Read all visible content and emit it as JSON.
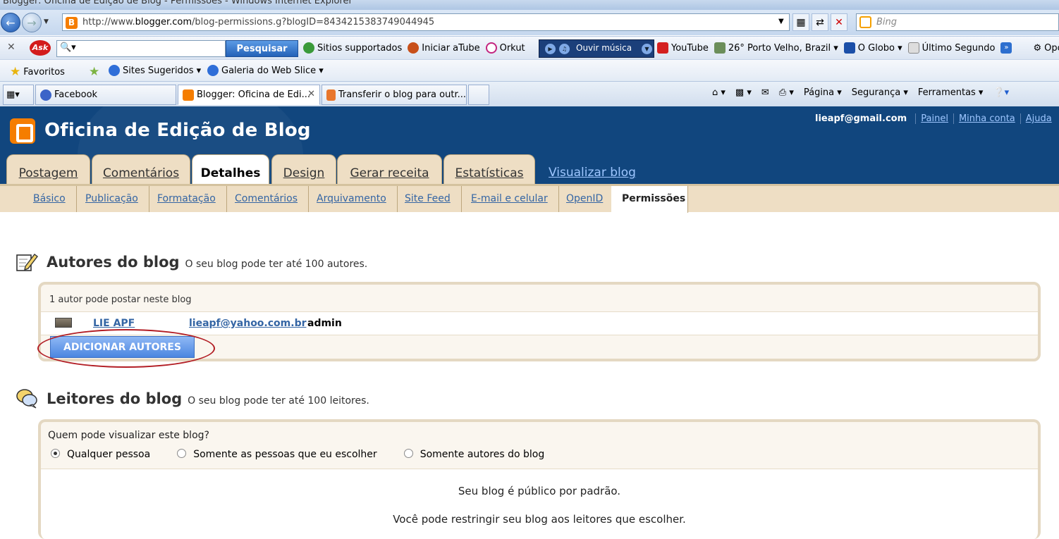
{
  "browser": {
    "window_title": "Blogger: Oficina de Edição de Blog - Permissões - Windows Internet Explorer",
    "url_prefix": "http://www.",
    "url_domain": "blogger.com",
    "url_path": "/blog-permissions.g?blogID=8434215383749044945",
    "search_placeholder": "Bing",
    "ask_toolbar": {
      "search_button": "Pesquisar",
      "links": [
        "Sitios supportados",
        "Iniciar aTube",
        "Orkut"
      ],
      "music_label": "Ouvir música",
      "links2": [
        "YouTube",
        "26° Porto Velho, Brazil ▾",
        "O Globo ▾",
        "Último Segundo"
      ],
      "more_label": "Opç"
    },
    "favorites": {
      "label": "Favoritos",
      "items": [
        "Sites Sugeridos ▾",
        "Galeria do Web Slice ▾"
      ]
    },
    "tabs": [
      {
        "label": "Facebook",
        "icon_color": "#3b64c8"
      },
      {
        "label": "Blogger: Oficina de Edi...",
        "icon_color": "#f57d00"
      },
      {
        "label": "Transferir o blog para outr...",
        "icon_color": "#e8762c"
      }
    ],
    "command_bar": [
      "Página ▾",
      "Segurança ▾",
      "Ferramentas ▾"
    ]
  },
  "blog": {
    "title": "Oficina de Edição de Blog",
    "user_email": "lieapf@gmail.com",
    "user_links": [
      "Painel",
      "Minha conta",
      "Ajuda"
    ],
    "main_tabs": [
      "Postagem",
      "Comentários",
      "Detalhes",
      "Design",
      "Gerar receita",
      "Estatísticas",
      "Visualizar blog"
    ],
    "sub_tabs": [
      "Básico",
      "Publicação",
      "Formatação",
      "Comentários",
      "Arquivamento",
      "Site Feed",
      "E-mail e celular",
      "OpenID",
      "Permissões"
    ]
  },
  "authors": {
    "heading": "Autores do blog",
    "note": "O seu blog pode ter até 100 autores.",
    "count_text": "1 autor pode postar neste blog",
    "rows": [
      {
        "name": "LIE APF",
        "email": "lieapf@yahoo.com.br",
        "role": "admin"
      }
    ],
    "add_button": "ADICIONAR AUTORES"
  },
  "readers": {
    "heading": "Leitores do blog",
    "note": "O seu blog pode ter até 100 leitores.",
    "question": "Quem pode visualizar este blog?",
    "options": [
      "Qualquer pessoa",
      "Somente as pessoas que eu escolher",
      "Somente autores do blog"
    ],
    "selected_index": 0,
    "info1": "Seu blog é público por padrão.",
    "info2": "Você pode restringir seu blog aos leitores que escolher."
  },
  "colors": {
    "header_blue": "#11467e",
    "tab_beige": "#eedec4",
    "link_blue": "#3465a4",
    "highlight_red": "#b21d24"
  }
}
